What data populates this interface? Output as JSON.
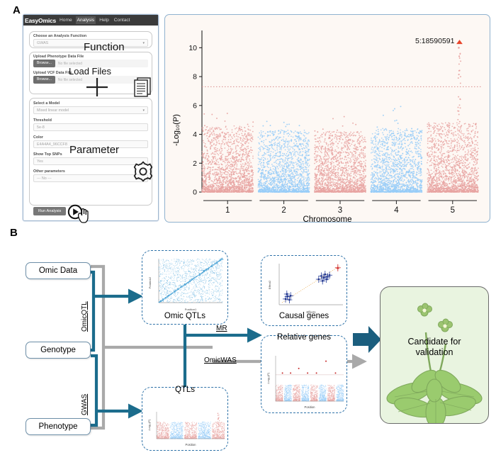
{
  "figure": {
    "panel_a_letter": "A",
    "panel_b_letter": "B"
  },
  "panel_a": {
    "app": {
      "brand": "EasyOmics",
      "nav_items": [
        {
          "label": "Home",
          "active": false
        },
        {
          "label": "Analysis",
          "active": true
        },
        {
          "label": "Help",
          "active": false
        },
        {
          "label": "Contact",
          "active": false
        }
      ],
      "function_card": {
        "label": "Choose an Analysis Function",
        "value": "GWAS",
        "caret": "chevron-down-icon"
      },
      "files_card": {
        "phenotype_label": "Upload Phenotype Data File",
        "phenotype_browse": "Browse...",
        "phenotype_status": "No file selected",
        "vcf_label": "Upload VCF Data File",
        "vcf_browse": "Browse...",
        "vcf_status": "No file selected"
      },
      "parameter_card": {
        "model_label": "Select a Model",
        "model_value": "Mixed linear model",
        "threshold_label": "Threshold",
        "threshold_value": "5e-8",
        "color_label": "Color",
        "color_value": "E4A4A4_96CCF8",
        "topsnp_label": "Show Top SNPs",
        "topsnp_value": "Yes",
        "other_label": "Other parameters",
        "other_value": "--- No ---"
      },
      "run_button": "Run Analysis"
    },
    "annotations": [
      {
        "text": "Function",
        "icon": null
      },
      {
        "text": "Load Files",
        "icon": "documents-icon"
      },
      {
        "text": "Parameter",
        "icon": "gear-icon"
      },
      {
        "text": "",
        "icon": "play-circle-icon"
      }
    ],
    "icons": {
      "plus": "plus-icon",
      "documents": "documents-icon",
      "gear": "gear-icon",
      "play": "play-circle-icon",
      "cursor": "hand-cursor-icon"
    },
    "chart_data": {
      "type": "scatter",
      "title": "",
      "xlabel": "Chromosome",
      "ylabel": "-Log₁₀(P)",
      "xticks": [
        "1",
        "2",
        "3",
        "4",
        "5"
      ],
      "yticks": [
        0,
        2,
        4,
        6,
        8,
        10
      ],
      "ylim": [
        0,
        11
      ],
      "grid": false,
      "legend": "none",
      "significance_threshold": 7.3,
      "threshold_line_style": "dotted",
      "annotation": {
        "label": "5:18590591",
        "marker": "triangle",
        "color": "#E8452B",
        "y": 10.0,
        "chromosome": 5
      },
      "colors": {
        "odd": "#E8A3A1",
        "even": "#96CCF8"
      },
      "chromosomes": [
        {
          "chr": 1,
          "color": "#E8A3A1",
          "max_logp": 5.9,
          "bulk_top": 4.6
        },
        {
          "chr": 2,
          "color": "#96CCF8",
          "max_logp": 4.9,
          "bulk_top": 4.3
        },
        {
          "chr": 3,
          "color": "#E8A3A1",
          "max_logp": 5.5,
          "bulk_top": 4.2
        },
        {
          "chr": 4,
          "color": "#96CCF8",
          "max_logp": 6.2,
          "bulk_top": 4.4
        },
        {
          "chr": 5,
          "color": "#E8A3A1",
          "max_logp": 10.0,
          "bulk_top": 4.8
        }
      ]
    }
  },
  "panel_b": {
    "inputs": [
      {
        "label": "Omic Data"
      },
      {
        "label": "Genotype"
      },
      {
        "label": "Phenotype"
      }
    ],
    "edge_labels": {
      "omicqtl": "OmicQTL",
      "gwas": "GWAS",
      "mr": "MR",
      "omicwas": "OmicWAS"
    },
    "result_boxes": [
      {
        "caption": "Omic QTLs",
        "xlabel": "Position1",
        "ylabel": "Position2",
        "plot_type": "scatter"
      },
      {
        "caption": "QTLs",
        "xlabel": "Position",
        "ylabel": "-Log₁₀(P)",
        "plot_type": "manhattan"
      },
      {
        "caption": "Causal genes",
        "xlabel": "Effect1",
        "ylabel": "Effect2",
        "plot_type": "scatter"
      },
      {
        "caption": "Relative genes",
        "xlabel": "Position",
        "ylabel": "-Log₁₀(P)",
        "plot_type": "manhattan"
      }
    ],
    "output": {
      "line1": "Candidate for",
      "line2": "validation",
      "illustration": "arabidopsis-plant-icon"
    },
    "colors": {
      "teal_arrow": "#1B6C8C",
      "gray_arrow": "#A9A9A9",
      "dashed_border": "#2E72A8",
      "green_panel": "#E9F4E0",
      "manhattan_pink": "#E8A3A1",
      "manhattan_blue": "#96CCF8",
      "block_arrow": "#1B5E7E"
    }
  }
}
